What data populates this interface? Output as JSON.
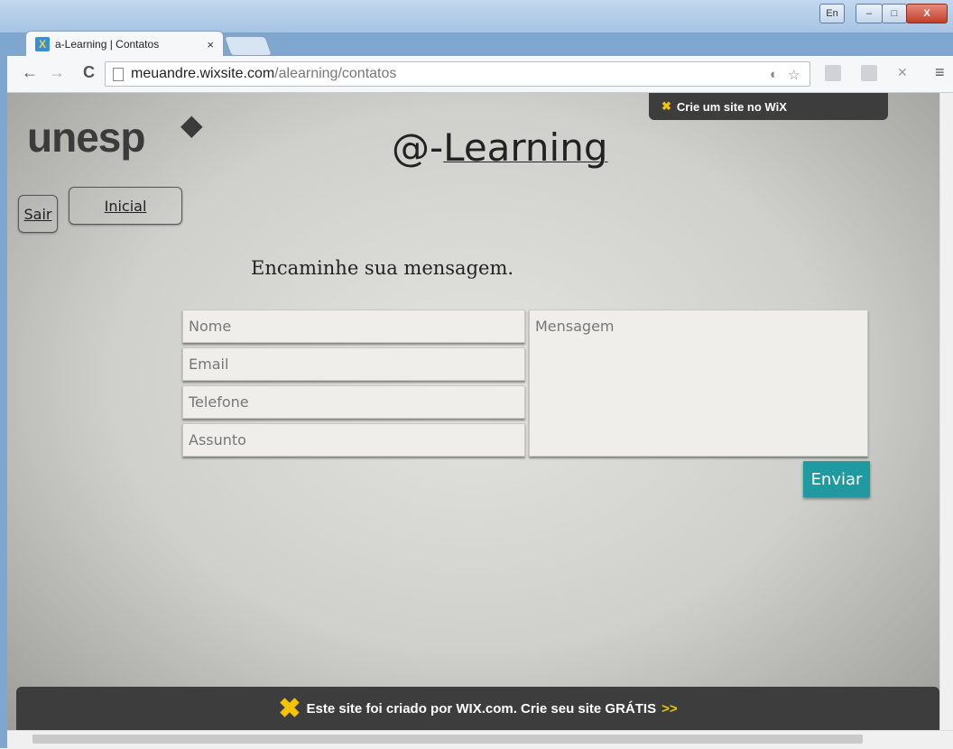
{
  "browser": {
    "tab_title": "a-Learning | Contatos",
    "tab_close": "×",
    "url_host": "meuandre.wixsite.com",
    "url_path": "/alearning/contatos",
    "window_lang": "En",
    "window_close": "X"
  },
  "site": {
    "logo_text": "unesp",
    "title_prefix": "@-",
    "title_underlined": "Learning",
    "wix_badge": "Crie um site no WiX",
    "nav": {
      "sair": "Sair",
      "inicial": "Inicial"
    },
    "heading": "Encaminhe sua mensagem."
  },
  "form": {
    "nome_placeholder": "Nome",
    "email_placeholder": "Email",
    "telefone_placeholder": "Telefone",
    "assunto_placeholder": "Assunto",
    "mensagem_placeholder": "Mensagem",
    "submit_label": "Enviar"
  },
  "footer": {
    "text": "Este site foi criado por WIX.com. Crie seu site GRÁTIS",
    "arrow": ">>"
  },
  "colors": {
    "accent": "#1e9aa0",
    "wix_yellow": "#f2c400",
    "banner_bg": "#3d3d3d"
  },
  "icons": [
    "back-icon",
    "forward-icon",
    "reload-icon",
    "page-icon",
    "star-icon",
    "menu-icon",
    "wix-x-icon"
  ]
}
